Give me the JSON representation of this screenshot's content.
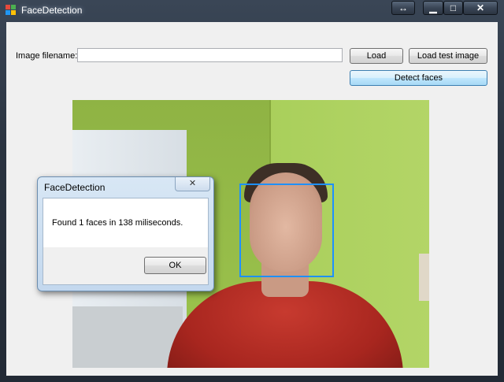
{
  "window": {
    "title": "FaceDetection",
    "caption_buttons": {
      "arrows": "↔",
      "minimize": "▁",
      "maximize": "□",
      "close": "✕"
    }
  },
  "form": {
    "filename_label": "Image filename:",
    "filename_value": "",
    "load_button": "Load",
    "load_test_button": "Load test image",
    "detect_button": "Detect faces"
  },
  "dialog": {
    "title": "FaceDetection",
    "close_glyph": "✕",
    "message": "Found 1 faces in 138 miliseconds.",
    "ok_button": "OK"
  },
  "colors": {
    "face_box": "#1e90ff",
    "detect_border": "#3c7fb1"
  }
}
